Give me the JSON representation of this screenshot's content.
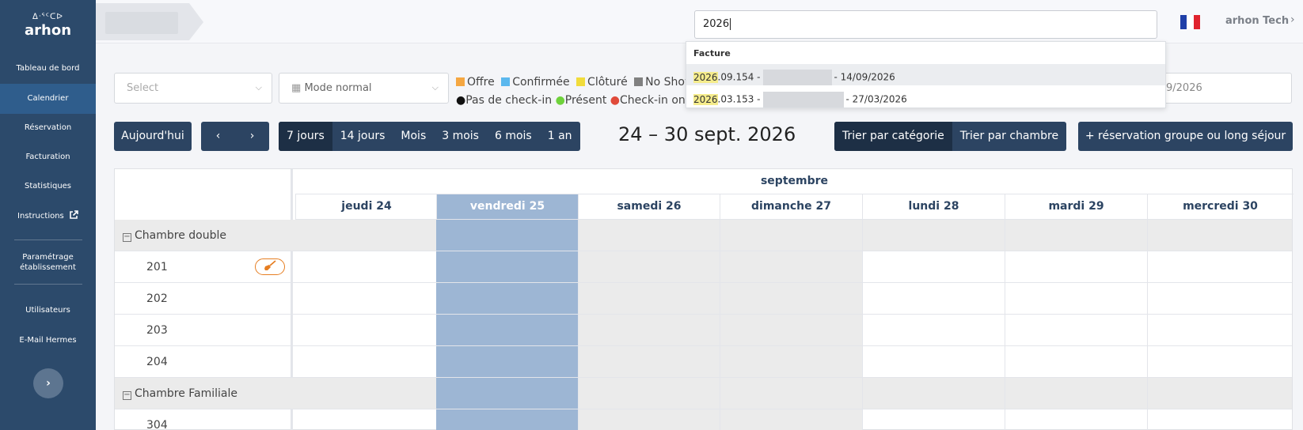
{
  "sidebar": {
    "logo_mark": "ᐃᐧᕐᑦᑕᐅ",
    "logo_text": "arhon",
    "items": [
      {
        "label": "Tableau de bord"
      },
      {
        "label": "Calendrier"
      },
      {
        "label": "Réservation"
      },
      {
        "label": "Facturation"
      },
      {
        "label": "Statistiques"
      },
      {
        "label": "Instructions"
      },
      {
        "label": "Paramétrage établissement"
      },
      {
        "label": "Utilisateurs"
      },
      {
        "label": "E-Mail Hermes"
      }
    ],
    "collapse_icon": "chevron-right-icon"
  },
  "topbar": {
    "search_value": "2026",
    "user_name": "arhon Tech",
    "flag": "france-flag",
    "flag_colors": [
      "#1f3fa8",
      "#ffffff",
      "#e0232e"
    ]
  },
  "search_dropdown": {
    "header": "Facture",
    "results": [
      {
        "highlight": "2026",
        "rest": ".09.154 -",
        "date": "- 14/09/2026"
      },
      {
        "highlight": "2026",
        "rest": ".03.153 -",
        "date": "- 27/03/2026"
      }
    ]
  },
  "filters": {
    "select_placeholder": "Select",
    "mode_label": "Mode normal",
    "date_partial": "9/2026"
  },
  "legend": {
    "status": [
      {
        "label": "Offre",
        "color": "#f5a742"
      },
      {
        "label": "Confirmée",
        "color": "#5bb8ee"
      },
      {
        "label": "Clôturé",
        "color": "#f1dc3b"
      },
      {
        "label": "No Show",
        "color": "#808080"
      }
    ],
    "checkin": [
      {
        "label": "Pas de check-in",
        "color": "#111111"
      },
      {
        "label": "Présent",
        "color": "#6fd23c"
      },
      {
        "label": "Check-in onlin",
        "color": "#e04a3a"
      }
    ]
  },
  "nav": {
    "today": "Aujourd'hui",
    "views": [
      "7 jours",
      "14 jours",
      "Mois",
      "3 mois",
      "6 mois",
      "1 an"
    ],
    "active_view": "7 jours",
    "range_title": "24 – 30 sept. 2026",
    "sort_category": "Trier par catégorie",
    "sort_room": "Trier par chambre",
    "group_booking": "+ réservation groupe ou long séjour"
  },
  "calendar": {
    "month": "septembre",
    "days": [
      "jeudi 24",
      "vendredi 25",
      "samedi 26",
      "dimanche 27",
      "lundi 28",
      "mardi 29",
      "mercredi 30"
    ],
    "selected_day": "vendredi 25",
    "rows": [
      {
        "type": "category",
        "label": "Chambre double"
      },
      {
        "type": "room",
        "label": "201",
        "badge": "broom-icon"
      },
      {
        "type": "room",
        "label": "202"
      },
      {
        "type": "room",
        "label": "203"
      },
      {
        "type": "room",
        "label": "204"
      },
      {
        "type": "category",
        "label": "Chambre Familiale"
      },
      {
        "type": "room",
        "label": "304"
      }
    ]
  }
}
